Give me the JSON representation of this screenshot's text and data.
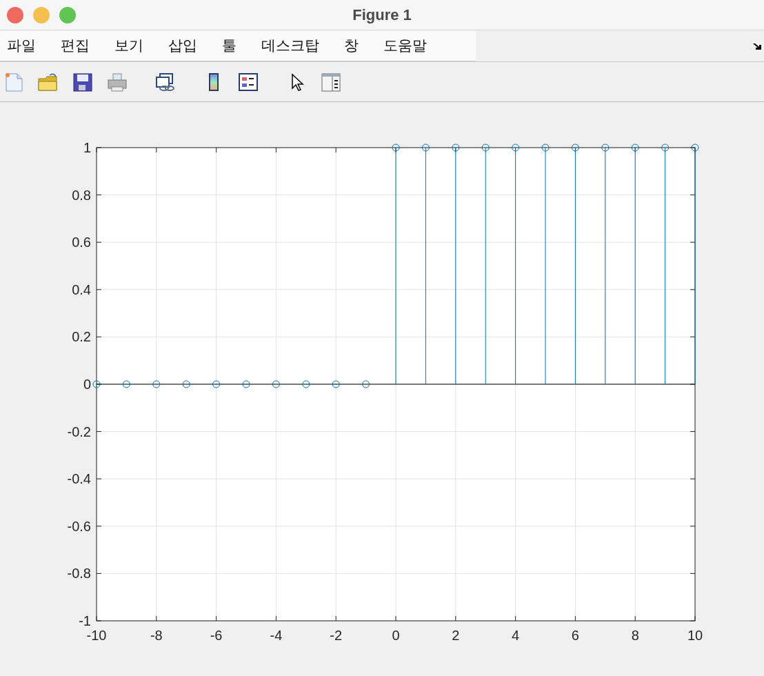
{
  "window": {
    "title": "Figure 1"
  },
  "menu": [
    "파일",
    "편집",
    "보기",
    "삽입",
    "툴",
    "데스크탑",
    "창",
    "도움말"
  ],
  "figure": {
    "chart_data": {
      "type": "scatter",
      "x": [
        -10,
        -9,
        -8,
        -7,
        -6,
        -5,
        -4,
        -3,
        -2,
        -1,
        0,
        1,
        2,
        3,
        4,
        5,
        6,
        7,
        8,
        9,
        10
      ],
      "grid": true,
      "series": [
        {
          "color": "#0072bd",
          "values": [
            0,
            0,
            0,
            0,
            0,
            0,
            0,
            0,
            0,
            0,
            1,
            1,
            1,
            1,
            1,
            1,
            1,
            1,
            1,
            1,
            1
          ]
        }
      ],
      "xlim": [
        -10,
        10
      ],
      "ylim": [
        -1,
        1
      ],
      "xticks": [
        -10,
        -8,
        -6,
        -4,
        -2,
        0,
        2,
        4,
        6,
        8,
        10
      ],
      "yticks": [
        -1,
        -0.8,
        -0.6,
        -0.4,
        -0.2,
        0,
        0.2,
        0.4,
        0.6,
        0.8,
        1
      ]
    }
  }
}
